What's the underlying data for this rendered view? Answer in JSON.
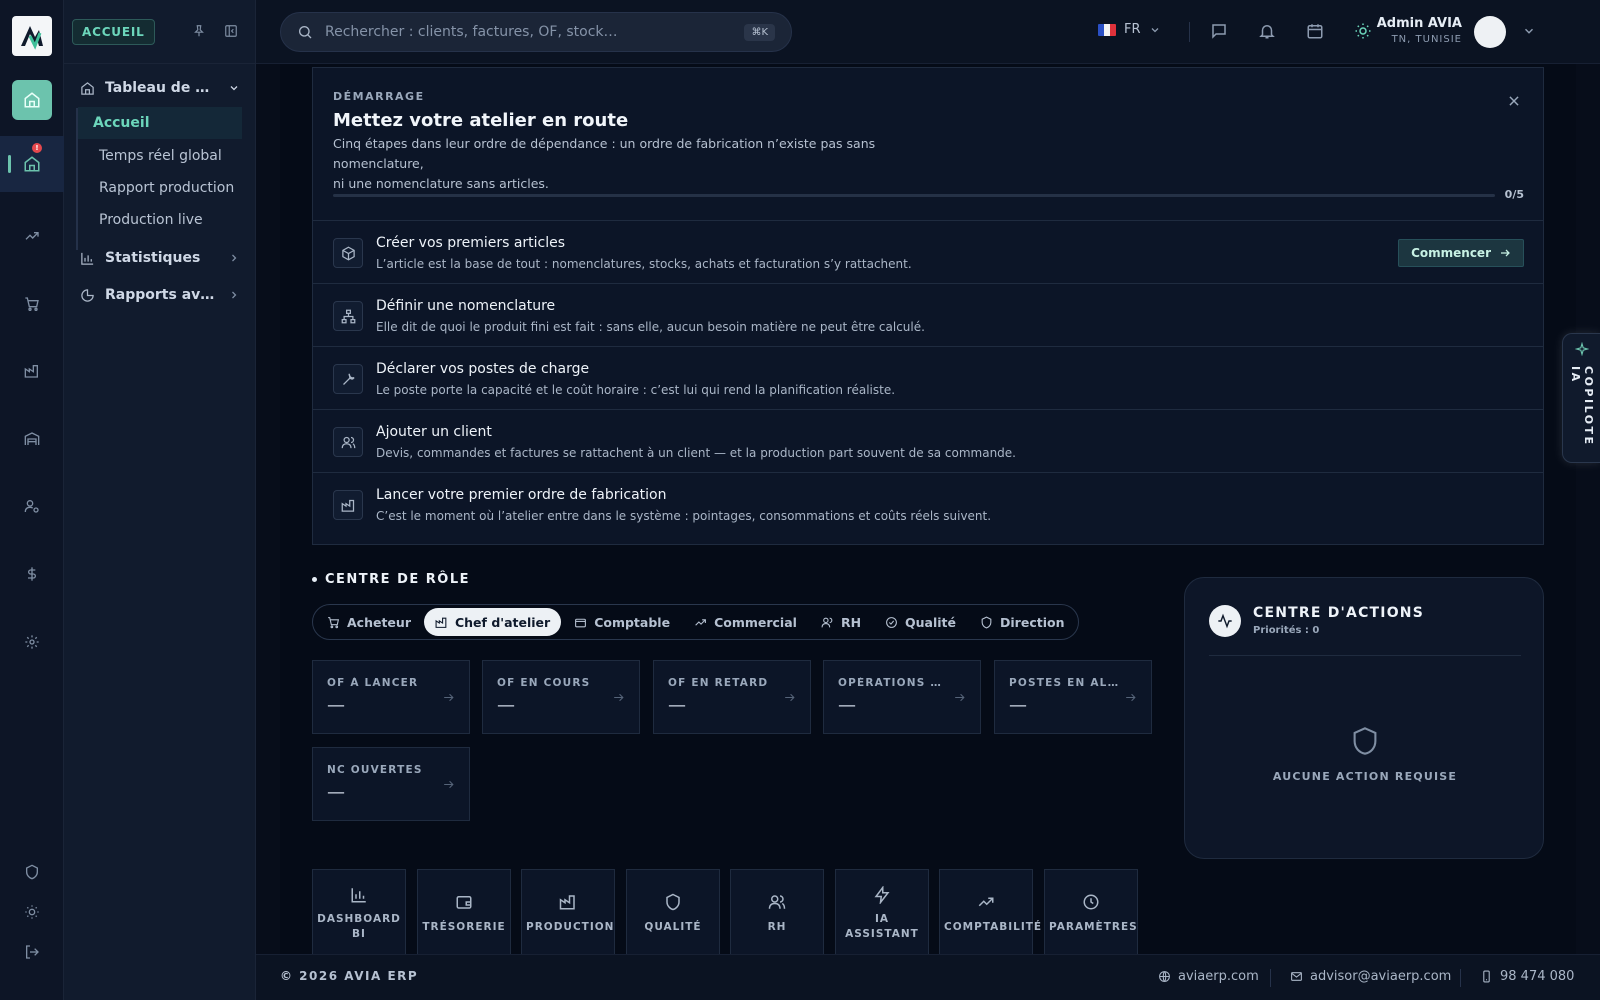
{
  "brand": {
    "logo_icon": "avia-logo-icon"
  },
  "nav_panel": {
    "section_label": "ACCUEIL",
    "groups": [
      {
        "label": "Tableau de bord",
        "icon": "home-icon"
      },
      {
        "label": "Statistiques",
        "icon": "bar-chart-icon"
      },
      {
        "label": "Rapports avancés",
        "icon": "pie-chart-icon"
      }
    ],
    "sub_items": [
      "Accueil",
      "Temps réel global",
      "Rapport production",
      "Production live"
    ]
  },
  "rail": {
    "alert_badge": "!"
  },
  "topbar": {
    "search_placeholder": "Rechercher : clients, factures, OF, stock…",
    "search_shortcut": "⌘K",
    "language": "FR",
    "user_name": "Admin AVIA",
    "user_region": "TN, TUNISIE"
  },
  "onboarding": {
    "eyebrow": "DÉMARRAGE",
    "title": "Mettez votre atelier en route",
    "description_line1": "Cinq étapes dans leur ordre de dépendance : un ordre de fabrication n’existe pas sans nomenclature,",
    "description_line2": "ni une nomenclature sans articles.",
    "progress": 0,
    "progress_label": "0/5",
    "start_label": "Commencer",
    "steps": [
      {
        "title": "Créer vos premiers articles",
        "desc": "L’article est la base de tout : nomenclatures, stocks, achats et facturation s’y rattachent.",
        "icon": "box-icon"
      },
      {
        "title": "Définir une nomenclature",
        "desc": "Elle dit de quoi le produit fini est fait : sans elle, aucun besoin matière ne peut être calculé.",
        "icon": "hierarchy-icon"
      },
      {
        "title": "Déclarer vos postes de charge",
        "desc": "Le poste porte la capacité et le coût horaire : c’est lui qui rend la planification réaliste.",
        "icon": "wrench-icon"
      },
      {
        "title": "Ajouter un client",
        "desc": "Devis, commandes et factures se rattachent à un client — et la production part souvent de sa commande.",
        "icon": "users-icon"
      },
      {
        "title": "Lancer votre premier ordre de fabrication",
        "desc": "C’est le moment où l’atelier entre dans le système : pointages, consommations et coûts réels suivent.",
        "icon": "factory-icon"
      }
    ]
  },
  "role_center": {
    "title": "CENTRE DE RÔLE",
    "roles": [
      "Acheteur",
      "Chef d'atelier",
      "Comptable",
      "Commercial",
      "RH",
      "Qualité",
      "Direction"
    ],
    "active_role": "Chef d'atelier",
    "kpis": [
      {
        "label": "OF À LANCER",
        "value": "—"
      },
      {
        "label": "OF EN COURS",
        "value": "—"
      },
      {
        "label": "OF EN RETARD",
        "value": "—"
      },
      {
        "label": "OPÉRATIONS EN ATTENTE",
        "value": "—"
      },
      {
        "label": "POSTES EN ALERTE",
        "value": "—"
      },
      {
        "label": "NC OUVERTES",
        "value": "—"
      }
    ]
  },
  "actions_center": {
    "title": "CENTRE D'ACTIONS",
    "subtitle": "Priorités : 0",
    "empty": "AUCUNE ACTION REQUISE"
  },
  "tiles": [
    {
      "label1": "DASHBOARD",
      "label2": "BI",
      "icon": "bar-chart-icon"
    },
    {
      "label1": "TRÉSORERIE",
      "label2": "",
      "icon": "wallet-icon"
    },
    {
      "label1": "PRODUCTION",
      "label2": "",
      "icon": "factory-icon"
    },
    {
      "label1": "QUALITÉ",
      "label2": "",
      "icon": "shield-icon"
    },
    {
      "label1": "RH",
      "label2": "",
      "icon": "users-icon"
    },
    {
      "label1": "IA",
      "label2": "ASSISTANT",
      "icon": "lightning-icon"
    },
    {
      "label1": "COMPTABILITÉ",
      "label2": "",
      "icon": "trending-up-icon"
    },
    {
      "label1": "PARAMÈTRES",
      "label2": "",
      "icon": "clock-icon"
    }
  ],
  "copilot": {
    "label": "COPILOTE IA"
  },
  "footer": {
    "copyright": "© 2026 AVIA ERP",
    "website": "aviaerp.com",
    "email": "advisor@aviaerp.com",
    "phone": "98 474 080"
  },
  "colors": {
    "accent": "#6cc3ad",
    "background": "#050b17",
    "panel": "#0c1527",
    "alert": "#e5484d"
  }
}
